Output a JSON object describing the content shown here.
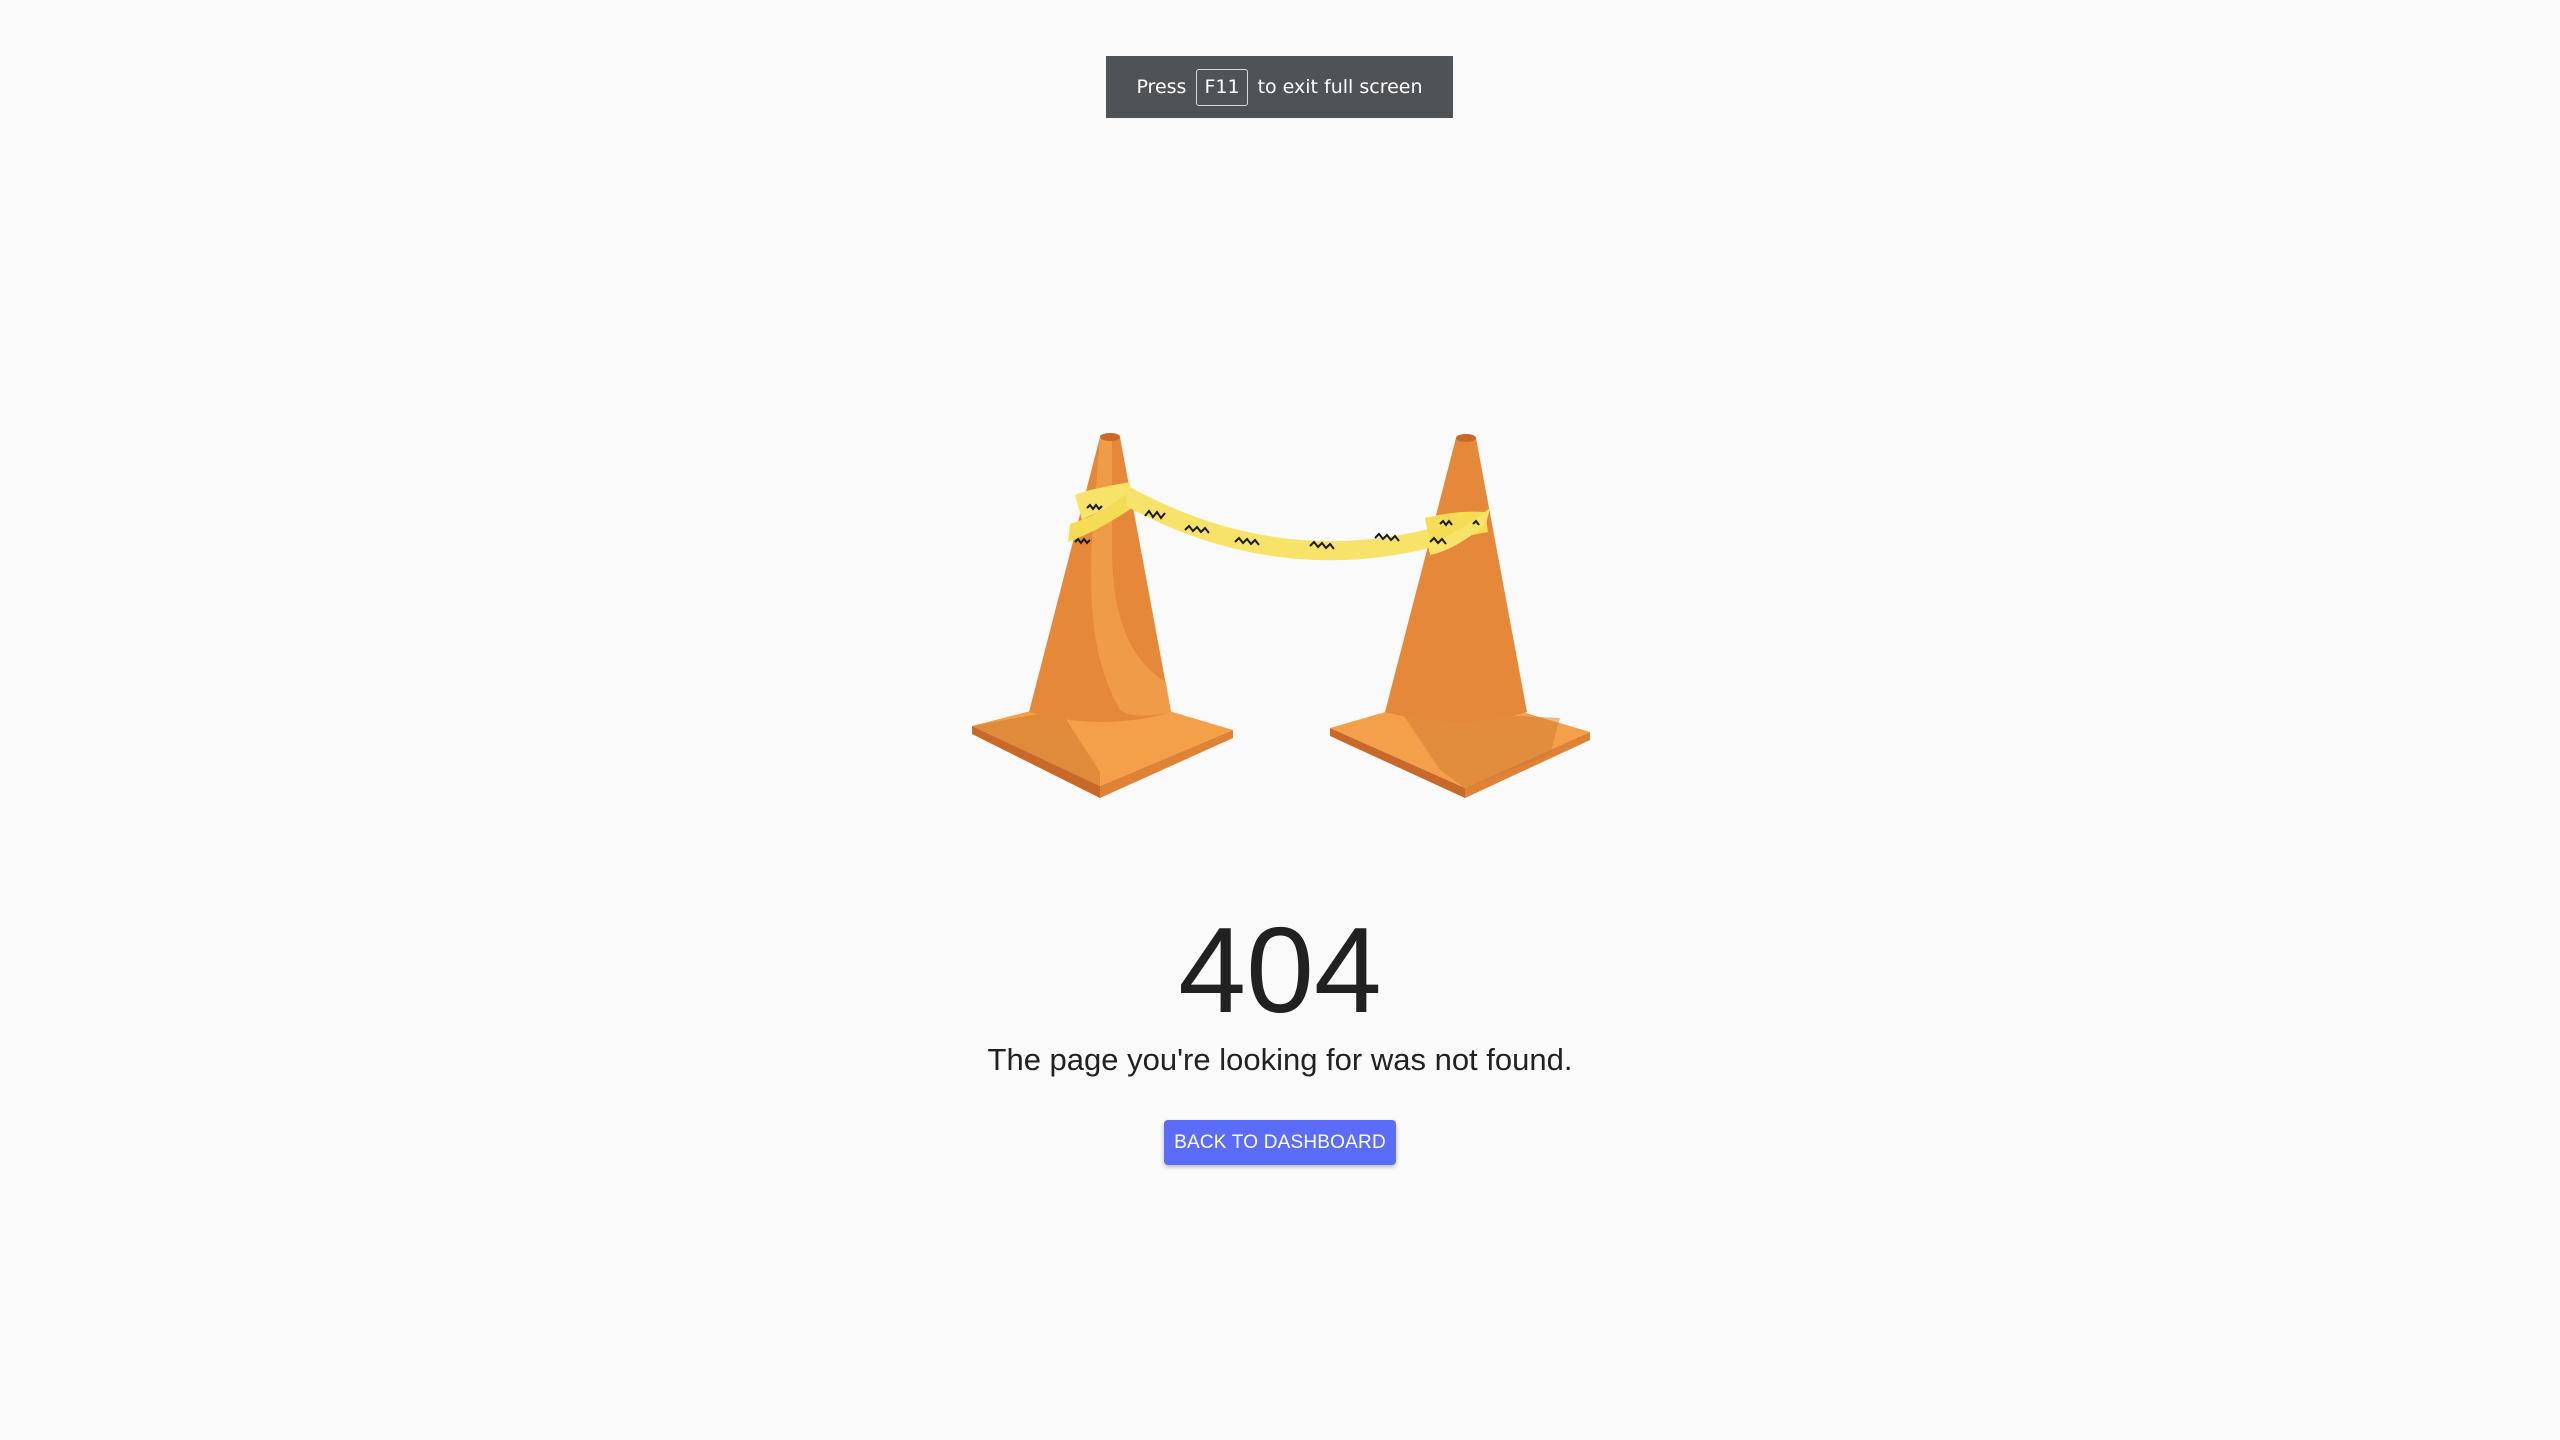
{
  "fullscreen_notice": {
    "prefix": "Press",
    "key": "F11",
    "suffix": "to exit full screen"
  },
  "illustration": {
    "icon": "traffic-cones-with-tape-icon",
    "cone_color": "#e5883a",
    "tape_color": "#f7e36a"
  },
  "error": {
    "code": "404",
    "message": "The page you're looking for was not found."
  },
  "actions": {
    "back_label": "BACK TO DASHBOARD",
    "button_color": "#5b6cf9"
  }
}
